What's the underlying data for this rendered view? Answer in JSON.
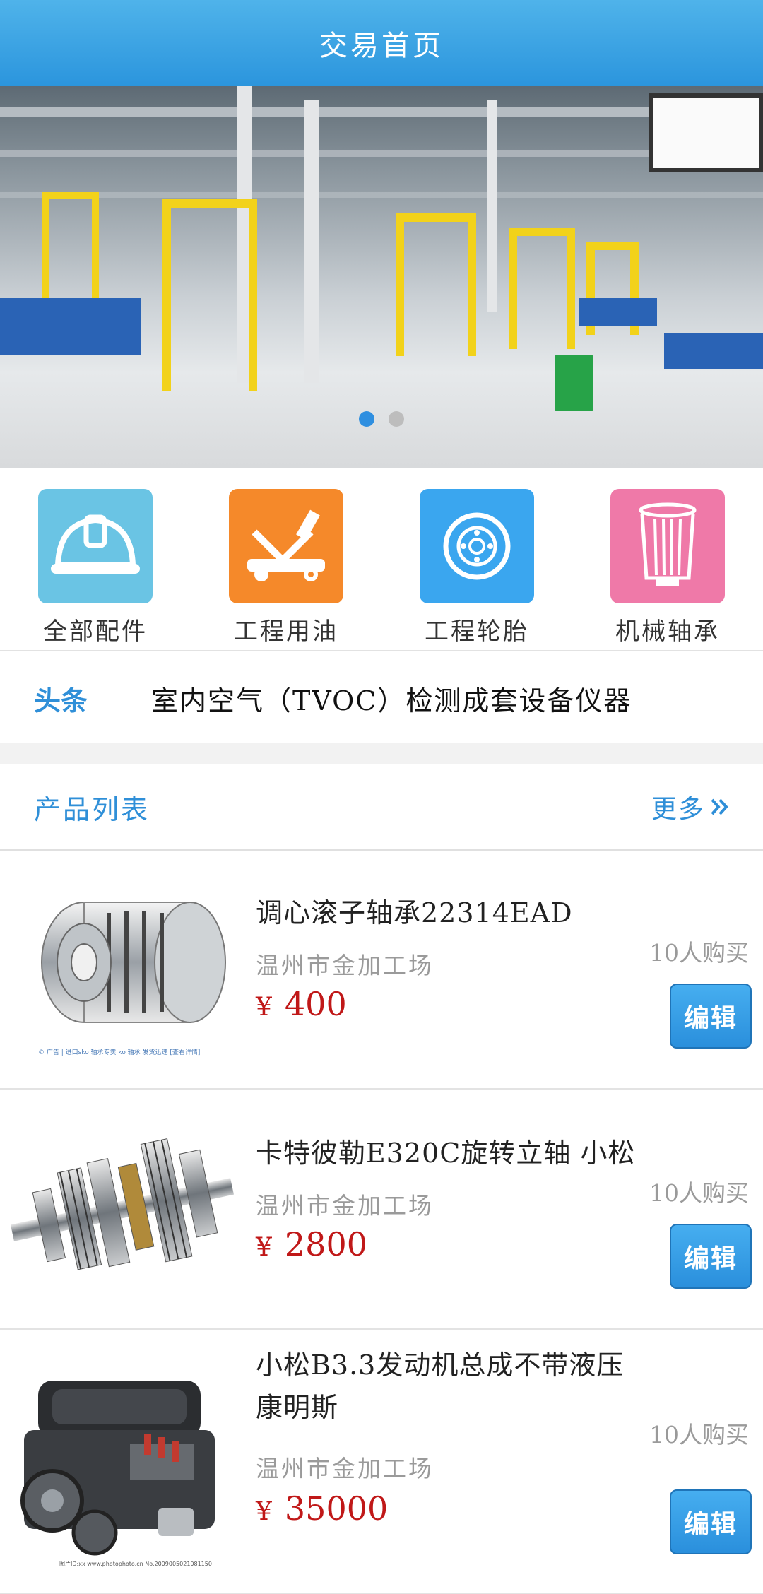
{
  "header": {
    "title": "交易首页"
  },
  "banner": {
    "dots": 2,
    "active_dot": 1
  },
  "categories": [
    {
      "label": "全部配件",
      "icon": "helmet-icon",
      "color": "#6ac4e4"
    },
    {
      "label": "工程用油",
      "icon": "jack-icon",
      "color": "#f5892a"
    },
    {
      "label": "工程轮胎",
      "icon": "tire-icon",
      "color": "#3aa6ef"
    },
    {
      "label": "机械轴承",
      "icon": "filter-icon",
      "color": "#ef79a8"
    }
  ],
  "headline": {
    "tag": "头条",
    "text": "室内空气（TVOC）检测成套设备仪器"
  },
  "product_list": {
    "title": "产品列表",
    "more": "更多",
    "items": [
      {
        "name": "调心滚子轴承22314EAD",
        "shop": "温州市金加工场",
        "currency": "¥",
        "price": "400",
        "buyers": "10人购买",
        "edit": "编辑",
        "image": "bearing-image"
      },
      {
        "name": "卡特彼勒E320C旋转立轴 小松",
        "shop": "温州市金加工场",
        "currency": "¥",
        "price": "2800",
        "buyers": "10人购买",
        "edit": "编辑",
        "image": "shaft-gear-image"
      },
      {
        "name": "小松B3.3发动机总成不带液压康明斯",
        "shop": "温州市金加工场",
        "currency": "¥",
        "price": "35000",
        "buyers": "10人购买",
        "edit": "编辑",
        "image": "engine-image"
      }
    ]
  }
}
